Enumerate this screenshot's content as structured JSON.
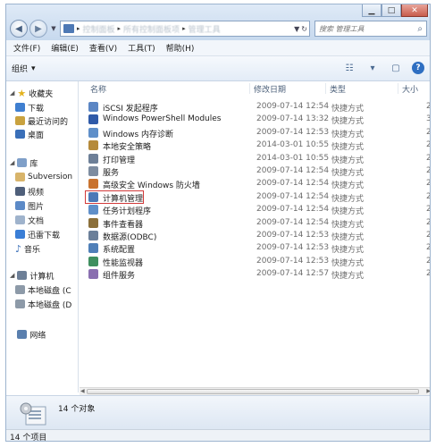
{
  "address": {
    "crumbs": [
      "控制面板",
      "所有控制面板项",
      "管理工具"
    ]
  },
  "search": {
    "placeholder": "搜索 管理工具"
  },
  "menu": [
    "文件(F)",
    "编辑(E)",
    "查看(V)",
    "工具(T)",
    "帮助(H)"
  ],
  "toolbar": {
    "organize_label": "组织"
  },
  "nav": {
    "favorites": "收藏夹",
    "favorites_items": [
      "下载",
      "最近访问的",
      "桌面"
    ],
    "libraries": "库",
    "libraries_items": [
      "Subversion",
      "视频",
      "图片",
      "文档",
      "迅雷下载",
      "音乐"
    ],
    "computer": "计算机",
    "computer_items": [
      "本地磁盘 (C",
      "本地磁盘 (D"
    ],
    "network": "网络"
  },
  "columns": {
    "name": "名称",
    "date": "修改日期",
    "type": "类型",
    "size": "大小"
  },
  "files": [
    {
      "name": "iSCSI 发起程序",
      "date": "2009-07-14 12:54",
      "type": "快捷方式",
      "size": "2"
    },
    {
      "name": "Windows PowerShell Modules",
      "date": "2009-07-14 13:32",
      "type": "快捷方式",
      "size": "3"
    },
    {
      "name": "Windows 内存诊断",
      "date": "2009-07-14 12:53",
      "type": "快捷方式",
      "size": "2"
    },
    {
      "name": "本地安全策略",
      "date": "2014-03-01 10:55",
      "type": "快捷方式",
      "size": "2"
    },
    {
      "name": "打印管理",
      "date": "2014-03-01 10:55",
      "type": "快捷方式",
      "size": "2"
    },
    {
      "name": "服务",
      "date": "2009-07-14 12:54",
      "type": "快捷方式",
      "size": "2"
    },
    {
      "name": "高级安全 Windows 防火墙",
      "date": "2009-07-14 12:54",
      "type": "快捷方式",
      "size": "2"
    },
    {
      "name": "计算机管理",
      "date": "2009-07-14 12:54",
      "type": "快捷方式",
      "size": "2"
    },
    {
      "name": "任务计划程序",
      "date": "2009-07-14 12:54",
      "type": "快捷方式",
      "size": "2"
    },
    {
      "name": "事件查看器",
      "date": "2009-07-14 12:54",
      "type": "快捷方式",
      "size": "2"
    },
    {
      "name": "数据源(ODBC)",
      "date": "2009-07-14 12:53",
      "type": "快捷方式",
      "size": "2"
    },
    {
      "name": "系统配置",
      "date": "2009-07-14 12:53",
      "type": "快捷方式",
      "size": "2"
    },
    {
      "name": "性能监视器",
      "date": "2009-07-14 12:53",
      "type": "快捷方式",
      "size": "2"
    },
    {
      "name": "组件服务",
      "date": "2009-07-14 12:57",
      "type": "快捷方式",
      "size": "2"
    }
  ],
  "details": {
    "count": "14 个对象"
  },
  "status": {
    "text": "14 个项目"
  },
  "colors": {
    "accent": "#2f6fc2",
    "highlight_box": "#d23a3a"
  }
}
